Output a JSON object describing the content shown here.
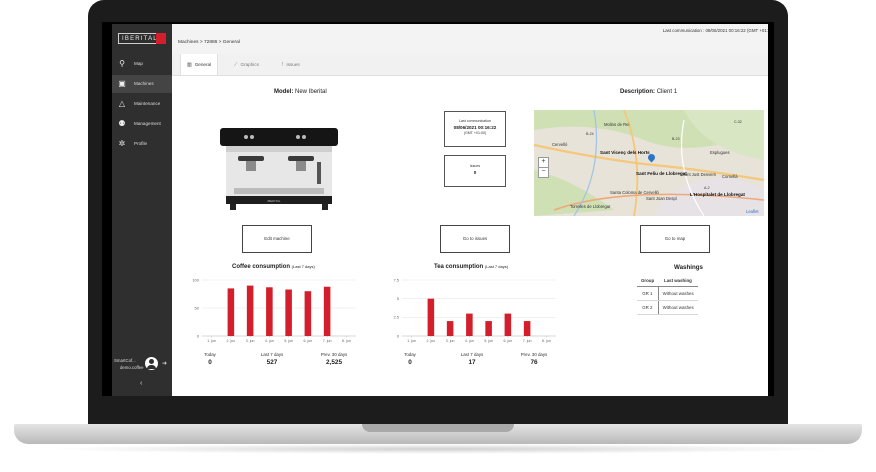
{
  "brand": {
    "logo_text": "IBERITAL"
  },
  "sidebar": {
    "items": [
      {
        "label": "Map",
        "icon": "map-pin-icon",
        "glyph": "⚲"
      },
      {
        "label": "Machines",
        "icon": "coffee-machine-icon",
        "glyph": "▣",
        "active": true
      },
      {
        "label": "Maintenance",
        "icon": "warning-icon",
        "glyph": "△"
      },
      {
        "label": "Management",
        "icon": "users-icon",
        "glyph": "⚉"
      },
      {
        "label": "Profile",
        "icon": "gear-icon",
        "glyph": "✲"
      }
    ],
    "user_name": "SmartCof...",
    "user_sub": "demo.coffee",
    "collapse_glyph": "‹"
  },
  "header": {
    "breadcrumb": "Machines  >  72886  >  General",
    "last_communication": "Last communication : 08/06/2021 00:16:22 (GMT +01:"
  },
  "tabs": [
    {
      "label": "General",
      "icon": "map-icon",
      "glyph": "▥"
    },
    {
      "label": "Graphics",
      "icon": "line-chart-icon",
      "glyph": "⟋"
    },
    {
      "label": "Issues",
      "icon": "exclamation-icon",
      "glyph": "!"
    }
  ],
  "overview": {
    "model_label": "Model:",
    "model_value": "New Iberital",
    "description_label": "Description:",
    "description_value": "Client 1",
    "machine_badge": "IBERITAL",
    "last_comm_box": {
      "label": "Last communication",
      "value": "08/06/2021 00:16:22",
      "tz": "(GMT +01:00)"
    },
    "issues_box": {
      "label": "Issues",
      "value": "0"
    }
  },
  "map": {
    "zoom_in": "+",
    "zoom_out": "−",
    "labels": [
      "Sant Vicenç dels Horts",
      "Sant Feliu de Llobregat",
      "Sant Just Desvern",
      "Santa Coloma de Cervelló",
      "Sant Joan Despí",
      "Torrelles de Llobregat",
      "L'Hospitalet de Llobregat",
      "Molins de Rei",
      "Cervelló",
      "Esplugues",
      "Cornellà",
      "Leaflet",
      "B-24",
      "B-23",
      "C-32",
      "A-2"
    ],
    "road_color": "#f4c77a",
    "park_color": "#cfe0b5",
    "pin_color": "#2a74c9"
  },
  "buttons": {
    "edit_machine": "Edit machine",
    "go_to_issues": "Go to issues",
    "go_to_map": "Go to map"
  },
  "coffee": {
    "title": "Coffee consumption",
    "subtitle": "(Last 7 days)",
    "stats": [
      {
        "label": "Today",
        "value": "0"
      },
      {
        "label": "Last 7 days",
        "value": "527"
      },
      {
        "label": "Prev. 30 days",
        "value": "2,525"
      }
    ]
  },
  "tea": {
    "title": "Tea consumption",
    "subtitle": "(Last 7 days)",
    "stats": [
      {
        "label": "Today",
        "value": "0"
      },
      {
        "label": "Last 7 days",
        "value": "17"
      },
      {
        "label": "Prev. 30 days",
        "value": "76"
      }
    ]
  },
  "washings": {
    "title": "Washings",
    "headers": [
      "Group",
      "Last washing"
    ],
    "rows": [
      [
        "GR 1",
        "Without washes"
      ],
      [
        "GR 2",
        "Without washes"
      ]
    ]
  },
  "colors": {
    "bar": "#d21f2b",
    "sidebar": "#2f2f2f",
    "accent_red": "#d21f2b"
  },
  "chart_data": [
    {
      "type": "bar",
      "title": "Coffee consumption",
      "subtitle": "(Last 7 days)",
      "categories": [
        "1. jun",
        "2. jun",
        "3. jun",
        "4. jun",
        "5. jun",
        "6. jun",
        "7. jun",
        "8. jun"
      ],
      "values": [
        0,
        85,
        90,
        87,
        83,
        80,
        88,
        0
      ],
      "yticks": [
        "0",
        "50",
        "100"
      ],
      "ylim": [
        0,
        100
      ],
      "grid": true
    },
    {
      "type": "bar",
      "title": "Tea consumption",
      "subtitle": "(Last 7 days)",
      "categories": [
        "1. jun",
        "2. jun",
        "3. jun",
        "4. jun",
        "5. jun",
        "6. jun",
        "7. jun",
        "8. jun"
      ],
      "values": [
        0,
        5,
        2,
        3,
        2,
        3,
        2,
        0
      ],
      "yticks": [
        "0",
        "2.5",
        "5",
        "7.5"
      ],
      "ylim": [
        0,
        7.5
      ],
      "grid": true
    }
  ]
}
